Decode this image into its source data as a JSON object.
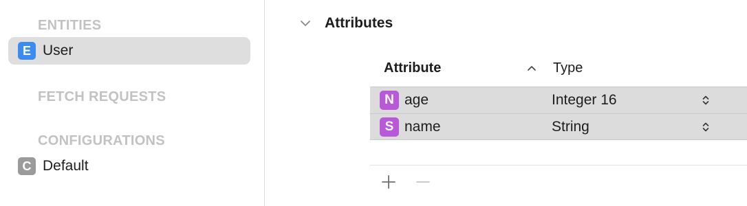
{
  "sidebar": {
    "entities_header": "ENTITIES",
    "entities": [
      {
        "badge": "E",
        "label": "User",
        "selected": true
      }
    ],
    "fetch_requests_header": "FETCH REQUESTS",
    "configurations_header": "CONFIGURATIONS",
    "configurations": [
      {
        "badge": "C",
        "label": "Default"
      }
    ]
  },
  "main": {
    "section_title": "Attributes",
    "table": {
      "col_attribute": "Attribute",
      "col_type": "Type",
      "rows": [
        {
          "badge": "N",
          "name": "age",
          "type": "Integer 16"
        },
        {
          "badge": "S",
          "name": "name",
          "type": "String"
        }
      ]
    }
  },
  "icons": {
    "chevron": "chevron-down-icon",
    "sort": "sort-ascending-icon",
    "stepper": "popup-stepper-icon",
    "add": "plus-icon",
    "remove": "minus-icon"
  },
  "colors": {
    "entity_badge": "#3a8cf0",
    "configuration_badge": "#9b9b9b",
    "attribute_badge": "#b85ad8",
    "selection": "#dedede",
    "section_header": "#c2c2c2"
  }
}
